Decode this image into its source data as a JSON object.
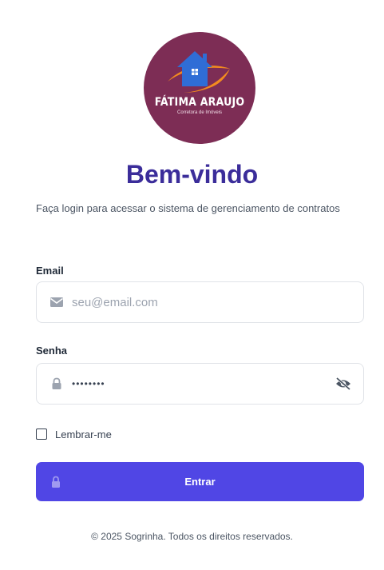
{
  "logo": {
    "brand": "FÁTIMA ARAUJO",
    "tagline": "Corretora de Imóveis",
    "icon": "house-logo-icon"
  },
  "heading": {
    "title": "Bem-vindo",
    "subtitle": "Faça login para acessar o sistema de gerenciamento de contratos"
  },
  "form": {
    "email": {
      "label": "Email",
      "placeholder": "seu@email.com",
      "value": "",
      "icon": "envelope-icon"
    },
    "password": {
      "label": "Senha",
      "value": "••••••••",
      "icon": "lock-icon",
      "toggle_icon": "eye-off-icon"
    },
    "remember": {
      "label": "Lembrar-me",
      "checked": false
    },
    "submit": {
      "label": "Entrar",
      "icon": "lock-icon"
    }
  },
  "footer": {
    "text": "© 2025 Sogrinha. Todos os direitos reservados."
  },
  "colors": {
    "primary": "#5046e5",
    "title": "#3b2d9a",
    "logo_bg": "#7d2d55",
    "logo_house": "#2f6dd6",
    "logo_swoosh": "#f28b1f"
  }
}
